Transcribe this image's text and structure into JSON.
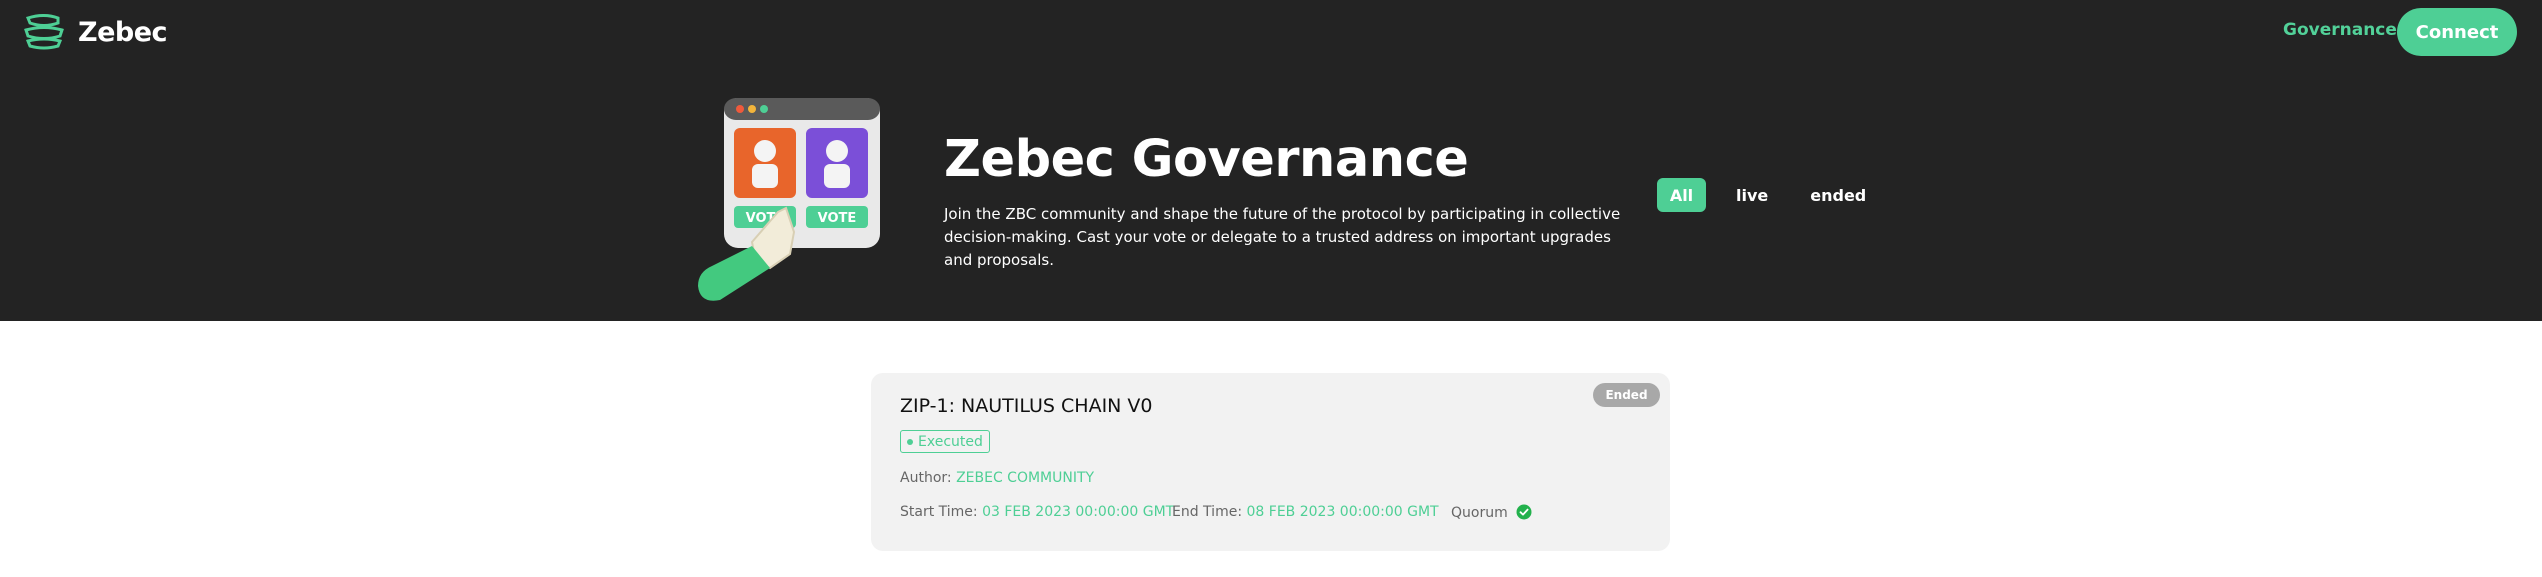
{
  "header": {
    "logo_text": "Zebec",
    "nav_governance": "Governance",
    "connect_label": "Connect"
  },
  "hero": {
    "title": "Zebec Governance",
    "description": "Join the ZBC community and shape the future of the protocol by participating in collective decision-making. Cast your vote or delegate to a trusted address on important upgrades and proposals.",
    "vote_label_left": "VOTE",
    "vote_label_right": "VOTE"
  },
  "filters": [
    {
      "label": "All",
      "active": true
    },
    {
      "label": "live",
      "active": false
    },
    {
      "label": "ended",
      "active": false
    }
  ],
  "proposal": {
    "badge": "Ended",
    "title": "ZIP-1: NAUTILUS CHAIN V0",
    "status": "Executed",
    "author_label": "Author:",
    "author": "ZEBEC COMMUNITY",
    "start_label": "Start Time:",
    "start_time": "03 FEB 2023 00:00:00 GMT",
    "end_label": "End Time:",
    "end_time": "08 FEB 2023 00:00:00 GMT",
    "quorum_label": "Quorum"
  },
  "colors": {
    "accent": "#4ecf95",
    "header_bg": "#232323",
    "card_bg": "#f2f2f2",
    "badge_bg": "#a8a8a8",
    "check": "#22b14c"
  },
  "icons": {
    "logo": "zebec-logo-icon",
    "quorum": "check-circle-icon",
    "illustration": "vote-window-illustration"
  }
}
